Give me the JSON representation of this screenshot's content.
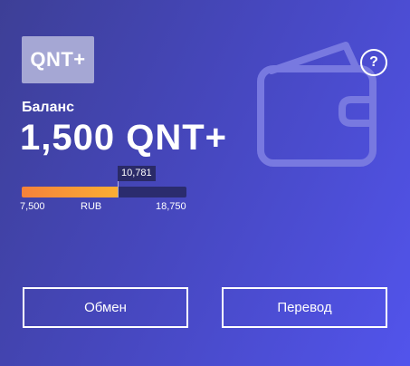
{
  "logo": {
    "text": "QNT+"
  },
  "help": {
    "label": "?"
  },
  "balance": {
    "label": "Баланс",
    "value": "1,500 QNT+"
  },
  "rate": {
    "current": "10,781",
    "min": "7,500",
    "max": "18,750",
    "unit": "RUB",
    "fill_fraction": 0.58
  },
  "colors": {
    "gradient_start": "#3d3f96",
    "gradient_end": "#5254ec",
    "fill_start": "#f5823a",
    "fill_end": "#fbae33"
  },
  "icons": {
    "wallet": "wallet-icon"
  },
  "actions": {
    "exchange_label": "Обмен",
    "transfer_label": "Перевод"
  }
}
